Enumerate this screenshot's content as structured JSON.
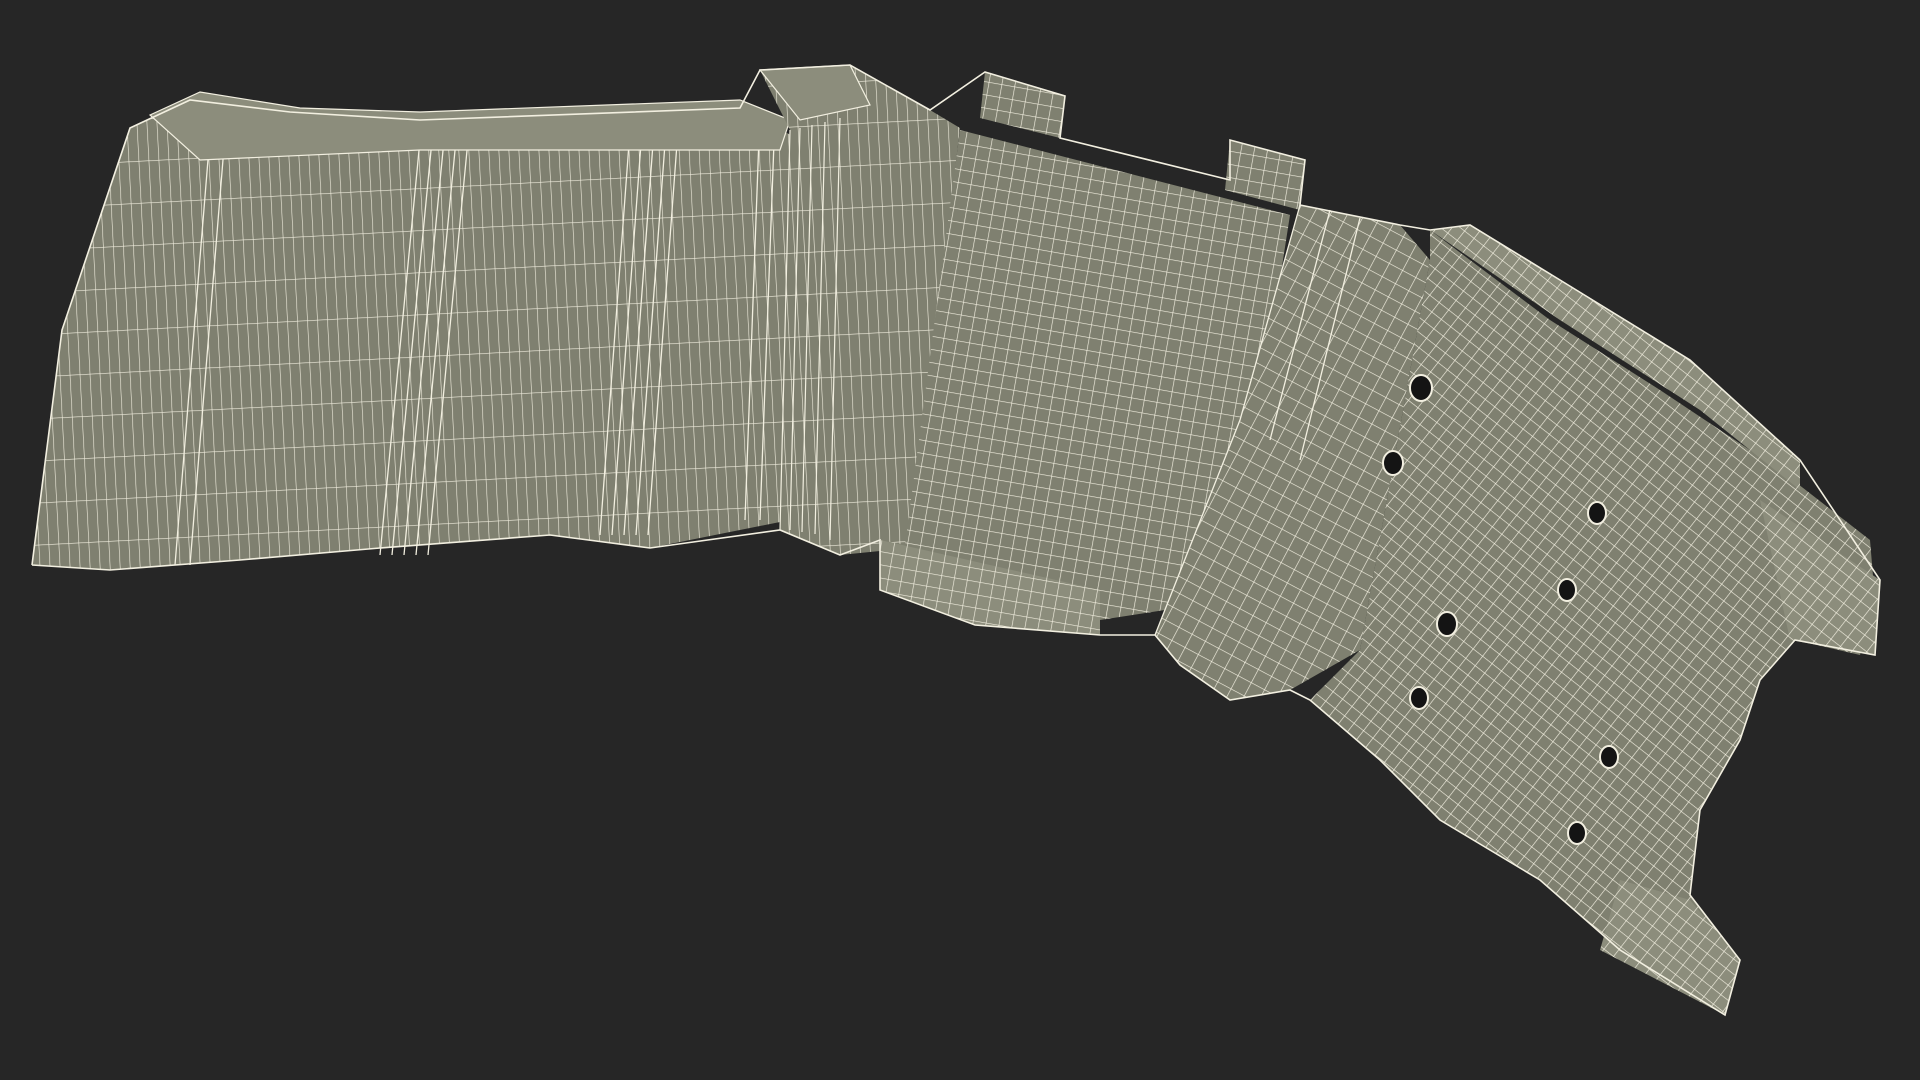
{
  "scene": {
    "background_color": "#262626",
    "surface_color": "#7f8070",
    "surface_shade_color": "#6d6e60",
    "surface_light_color": "#8c8d7c",
    "wire_color": "#f2efe0",
    "hole_color": "#141414",
    "object": "bracket-wireframe-mesh"
  }
}
